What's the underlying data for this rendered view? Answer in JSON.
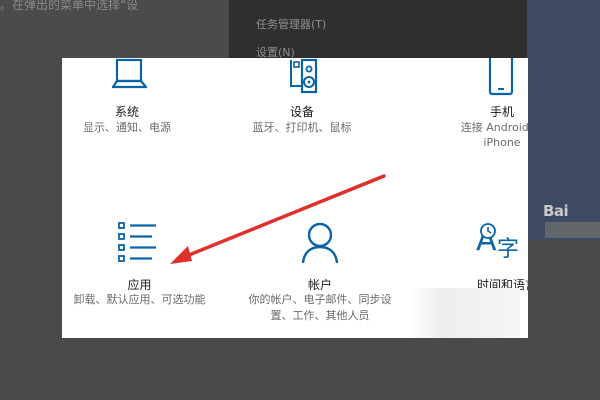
{
  "background": {
    "hint_text": "。在弹出的菜单中选择“设",
    "menu_items": [
      "任务管理器(T)",
      "设置(N)"
    ],
    "watermark": "Bai"
  },
  "settings": {
    "tiles": [
      {
        "title": "系统",
        "desc": "显示、通知、电源",
        "icon": "laptop-icon"
      },
      {
        "title": "设备",
        "desc": "蓝牙、打印机、鼠标",
        "icon": "devices-icon"
      },
      {
        "title": "手机",
        "desc_line1": "连接 Android 设",
        "desc_line2": "iPhone",
        "icon": "phone-icon"
      },
      {
        "title": "应用",
        "desc": "卸载、默认应用、可选功能",
        "icon": "apps-list-icon"
      },
      {
        "title": "帐户",
        "desc": "你的帐户、电子邮件、同步设置、工作、其他人员",
        "icon": "person-icon"
      },
      {
        "title": "时间和语言",
        "icon": "time-language-icon"
      }
    ]
  },
  "colors": {
    "accent": "#0a64a8",
    "annotation_arrow": "#e0302a"
  }
}
